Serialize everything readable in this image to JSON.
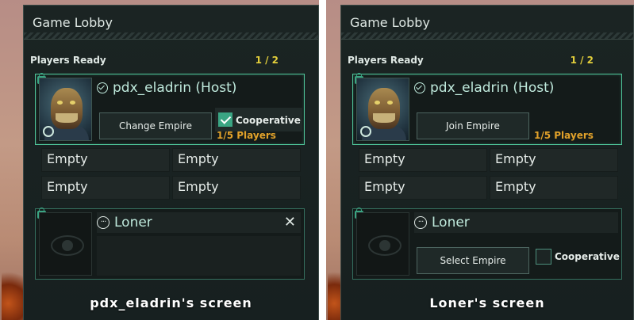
{
  "colors": {
    "accent": "#4fc59a",
    "ready_count": "#e3cf3b",
    "players_count": "#e1a12a",
    "panel_bg": "#1b2423"
  },
  "left": {
    "title": "Game Lobby",
    "section": "Players Ready",
    "ready_count": "1 / 2",
    "host": {
      "name": "pdx_eladrin (Host)",
      "status_icon": "check-circle-icon",
      "button": "Change Empire",
      "cooperative_checked": true,
      "cooperative_label": "Cooperative",
      "players": "1/5 Players"
    },
    "empty_slots": [
      "Empty",
      "Empty",
      "Empty",
      "Empty"
    ],
    "loner": {
      "name": "Loner",
      "status_icon": "ellipsis-circle-icon"
    },
    "caption": "pdx_eladrin's screen"
  },
  "right": {
    "title": "Game Lobby",
    "section": "Players Ready",
    "ready_count": "1 / 2",
    "host": {
      "name": "pdx_eladrin (Host)",
      "status_icon": "check-circle-icon",
      "button": "Join Empire",
      "players": "1/5 Players"
    },
    "empty_slots": [
      "Empty",
      "Empty",
      "Empty",
      "Empty"
    ],
    "loner": {
      "name": "Loner",
      "status_icon": "ellipsis-circle-icon",
      "button": "Select Empire",
      "cooperative_checked": false,
      "cooperative_label": "Cooperative"
    },
    "caption": "Loner's screen"
  }
}
